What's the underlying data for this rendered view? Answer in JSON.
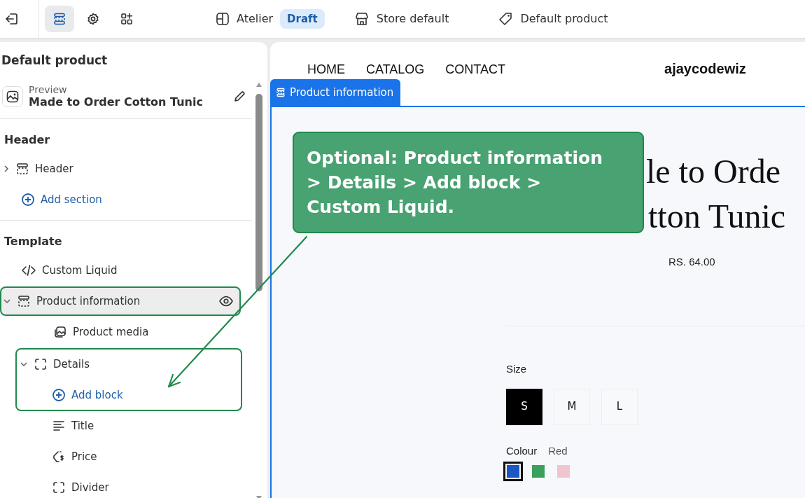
{
  "toolbar": {
    "tools": [
      {
        "kind": "sections",
        "selected": true
      },
      {
        "kind": "settings",
        "selected": false
      },
      {
        "kind": "apps",
        "selected": false
      }
    ],
    "theme": {
      "name": "Atelier",
      "badge": "Draft"
    },
    "store": "Store default",
    "template": "Default product"
  },
  "sidebar": {
    "title": "Default product",
    "preview": {
      "label": "Preview",
      "value": "Made to Order Cotton Tunic"
    },
    "groups": [
      {
        "heading": "Header",
        "items": [
          {
            "kind": "section",
            "label": "Header",
            "expanded": false,
            "selected": false,
            "highlighted": false
          }
        ],
        "add_label": "Add section"
      },
      {
        "heading": "Template",
        "items": [
          {
            "kind": "code",
            "label": "Custom Liquid",
            "selected": false,
            "highlighted": false
          },
          {
            "kind": "section",
            "label": "Product information",
            "expanded": true,
            "selected": true,
            "highlighted": true,
            "children": [
              {
                "kind": "media",
                "label": "Product media",
                "selected": false,
                "highlighted": false
              },
              {
                "kind": "group",
                "label": "Details",
                "expanded": true,
                "selected": false,
                "highlighted": true,
                "add_label": "Add block",
                "children": [
                  {
                    "kind": "text",
                    "label": "Title",
                    "selected": false,
                    "highlighted": false
                  },
                  {
                    "kind": "price",
                    "label": "Price",
                    "selected": false,
                    "highlighted": false
                  },
                  {
                    "kind": "group",
                    "label": "Divider",
                    "selected": false,
                    "highlighted": false
                  }
                ]
              }
            ]
          }
        ]
      }
    ]
  },
  "preview": {
    "nav": [
      "HOME",
      "CATALOG",
      "CONTACT"
    ],
    "brand": "ajaycodewiz",
    "section_tag": "Product information",
    "heading_lines": [
      "le to Orde",
      "tton Tunic"
    ],
    "price": "RS. 64.00",
    "size_label": "Size",
    "sizes": [
      {
        "label": "S",
        "selected": true
      },
      {
        "label": "M",
        "selected": false
      },
      {
        "label": "L",
        "selected": false
      }
    ],
    "colour_label": "Colour",
    "colour_value": "Red",
    "swatches": [
      {
        "color": "#1a56c4",
        "selected": true
      },
      {
        "color": "#3aa05a",
        "selected": false
      },
      {
        "color": "#f2c4d0",
        "selected": false
      }
    ]
  },
  "callout": {
    "text": "Optional: Product information > Details > Add block > Custom Liquid."
  }
}
